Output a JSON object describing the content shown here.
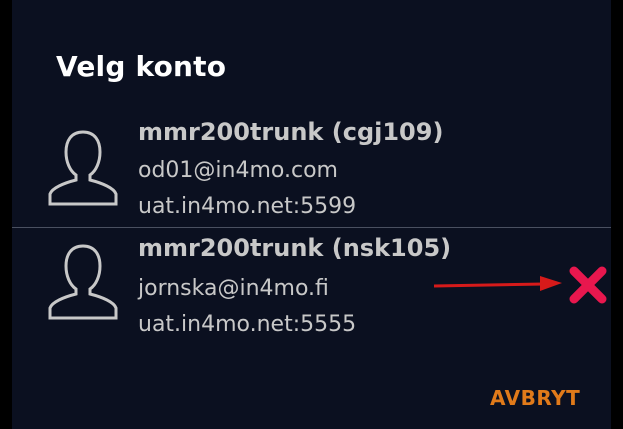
{
  "dialog": {
    "title": "Velg konto",
    "cancel_label": "AVBRYT"
  },
  "accounts": [
    {
      "name": "mmr200trunk (cgj109)",
      "email": "od01@in4mo.com",
      "server": "uat.in4mo.net:5599",
      "icon": "person-outline-icon"
    },
    {
      "name": "mmr200trunk (nsk105)",
      "email": "jornska@in4mo.fi",
      "server": "uat.in4mo.net:5555",
      "icon": "person-outline-icon",
      "action_icon": "delete-x-icon"
    }
  ],
  "colors": {
    "background": "#0b1020",
    "text": "#c8c8c8",
    "title": "#ffffff",
    "accent": "#e07a1a",
    "delete": "#e8174e",
    "arrow": "#d61a1a"
  }
}
